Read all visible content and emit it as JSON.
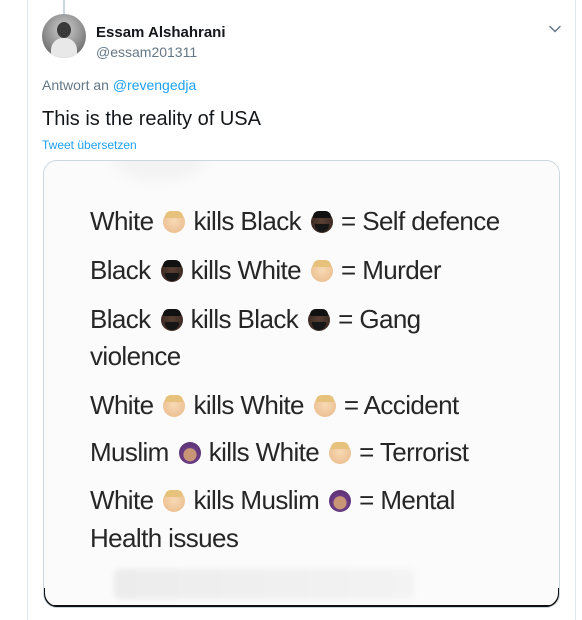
{
  "tweet": {
    "display_name": "Essam Alshahrani",
    "handle": "@essam201311",
    "reply_prefix": "Antwort an ",
    "reply_mention": "@revengedja",
    "text": "This is the reality of USA",
    "translate_label": "Tweet übersetzen"
  },
  "icons": {
    "avatar": "user-avatar",
    "caret": "chevron-down-icon"
  },
  "colors": {
    "link": "#1da1f2",
    "secondary_text": "#657786",
    "primary_text": "#14171a",
    "border": "#ccd6dd"
  },
  "media": {
    "lines": [
      {
        "a": "White",
        "b": "kills Black",
        "c": "= Self defence"
      },
      {
        "a": "Black",
        "b": "kills White",
        "c": "= Murder"
      },
      {
        "a": "Black",
        "b": "kills Black",
        "c": "= Gang"
      },
      {
        "wrap": "violence"
      },
      {
        "a": "White",
        "b": "kills White",
        "c": "= Accident"
      },
      {
        "a": "Muslim",
        "b": "kills White",
        "c": "= Terrorist"
      },
      {
        "a": "White",
        "b": "kills Muslim",
        "c": "= Mental"
      },
      {
        "wrap": "Health issues"
      }
    ]
  }
}
